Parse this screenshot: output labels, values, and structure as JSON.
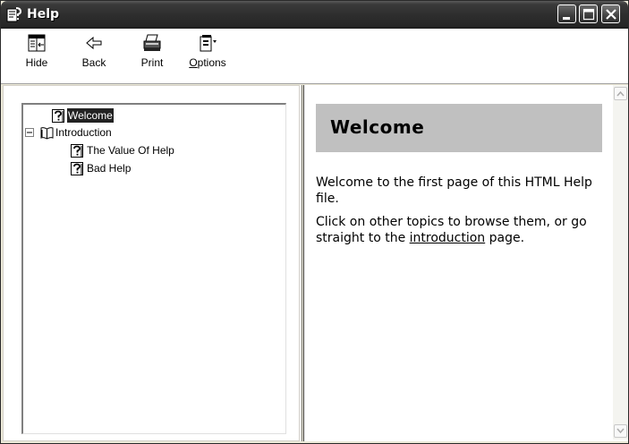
{
  "window": {
    "title": "Help"
  },
  "toolbar": {
    "hide_label": "Hide",
    "back_label": "Back",
    "print_label": "Print",
    "options_label": "Options",
    "options_mnemonic": "O"
  },
  "tree": {
    "nodes": [
      {
        "label": "Welcome",
        "type": "topic",
        "selected": true
      },
      {
        "label": "Introduction",
        "type": "book",
        "expanded": true
      },
      {
        "label": "The Value Of Help",
        "type": "topic"
      },
      {
        "label": "Bad Help",
        "type": "topic"
      }
    ]
  },
  "page": {
    "heading": "Welcome",
    "para1": "Welcome to the first page of this HTML Help file.",
    "para2_before": "Click on other topics to browse them, or go straight to the ",
    "para2_link": "introduction",
    "para2_after": " page."
  },
  "colors": {
    "titlebar": "#2e2e2e",
    "selection": "#222222",
    "heading_bg": "#c0c0c0"
  },
  "icons": [
    "help-page-icon",
    "minimize-icon",
    "maximize-icon",
    "close-icon",
    "hide-icon",
    "back-arrow-icon",
    "printer-icon",
    "options-icon",
    "question-page-icon",
    "book-icon",
    "collapse-minus-icon",
    "scroll-up-icon",
    "scroll-down-icon"
  ]
}
